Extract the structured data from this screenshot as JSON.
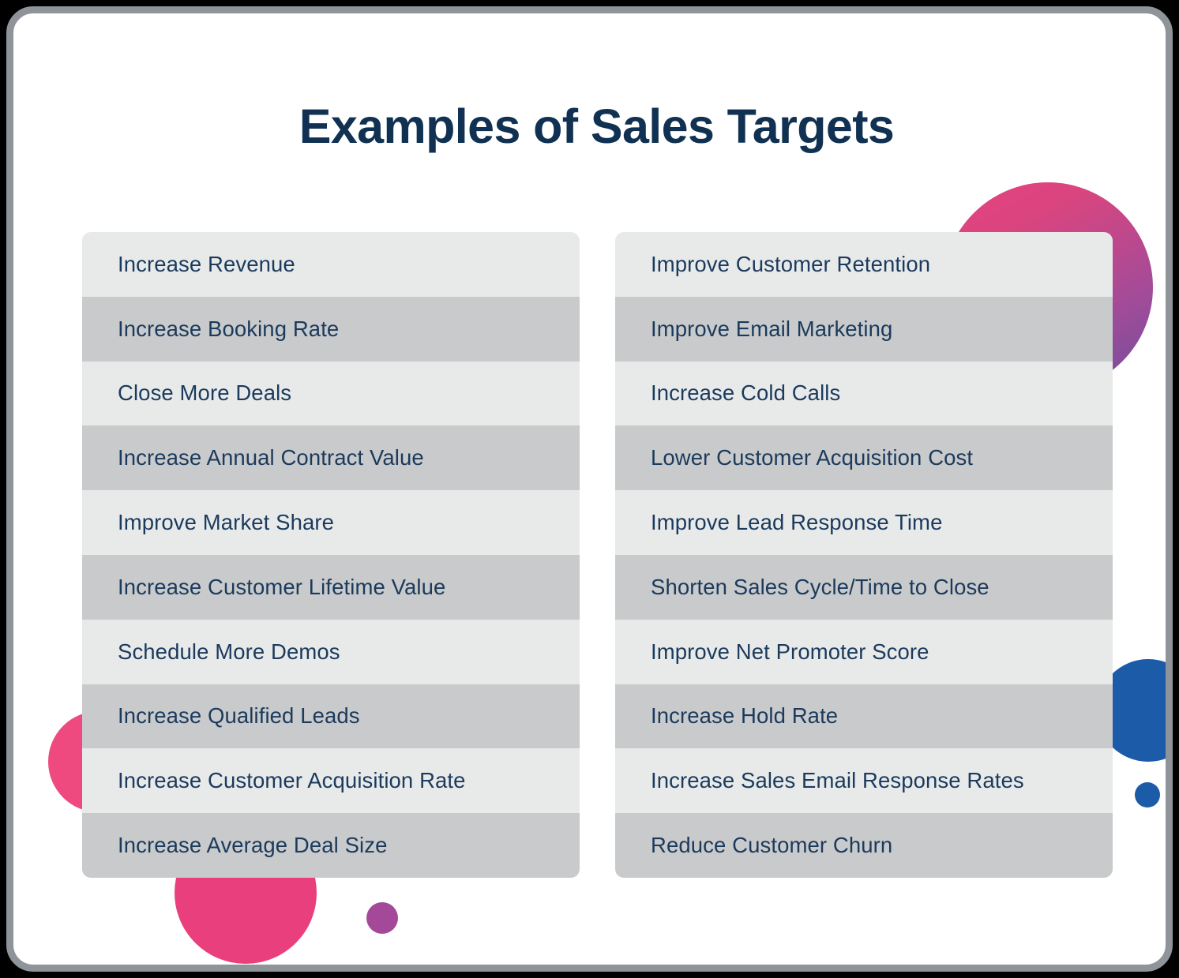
{
  "page": {
    "title": "Examples of Sales Targets",
    "background_color": "#ffffff",
    "frame_border_color": "#8e9499",
    "title_color": "#103152",
    "row_text_color": "#1b3a5c",
    "row_color_odd": "#e8eaea",
    "row_color_even": "#c9cacb"
  },
  "decorations": [
    {
      "name": "gradient-circle-top-right",
      "color": "#e8427f",
      "color_end": "#6e4f9e"
    },
    {
      "name": "pink-circle-left",
      "color": "#ee4a80"
    },
    {
      "name": "pink-circle-bottom",
      "color": "#ea3f7d"
    },
    {
      "name": "purple-dot-bottom",
      "color": "#a4499a"
    },
    {
      "name": "blue-circle-right",
      "color": "#1c5ba8"
    },
    {
      "name": "blue-dot-right",
      "color": "#1c5ba8"
    }
  ],
  "columns": {
    "left": [
      "Increase Revenue",
      "Increase Booking Rate",
      "Close More Deals",
      "Increase Annual Contract Value",
      "Improve Market Share",
      "Increase Customer Lifetime Value",
      "Schedule More Demos",
      "Increase Qualified Leads",
      "Increase Customer Acquisition Rate",
      "Increase Average Deal Size"
    ],
    "right": [
      "Improve Customer Retention",
      "Improve Email Marketing",
      "Increase Cold Calls",
      "Lower Customer Acquisition Cost",
      "Improve Lead Response Time",
      "Shorten Sales Cycle/Time to Close",
      "Improve Net Promoter Score",
      "Increase Hold Rate",
      "Increase Sales Email Response Rates",
      "Reduce Customer Churn"
    ]
  }
}
